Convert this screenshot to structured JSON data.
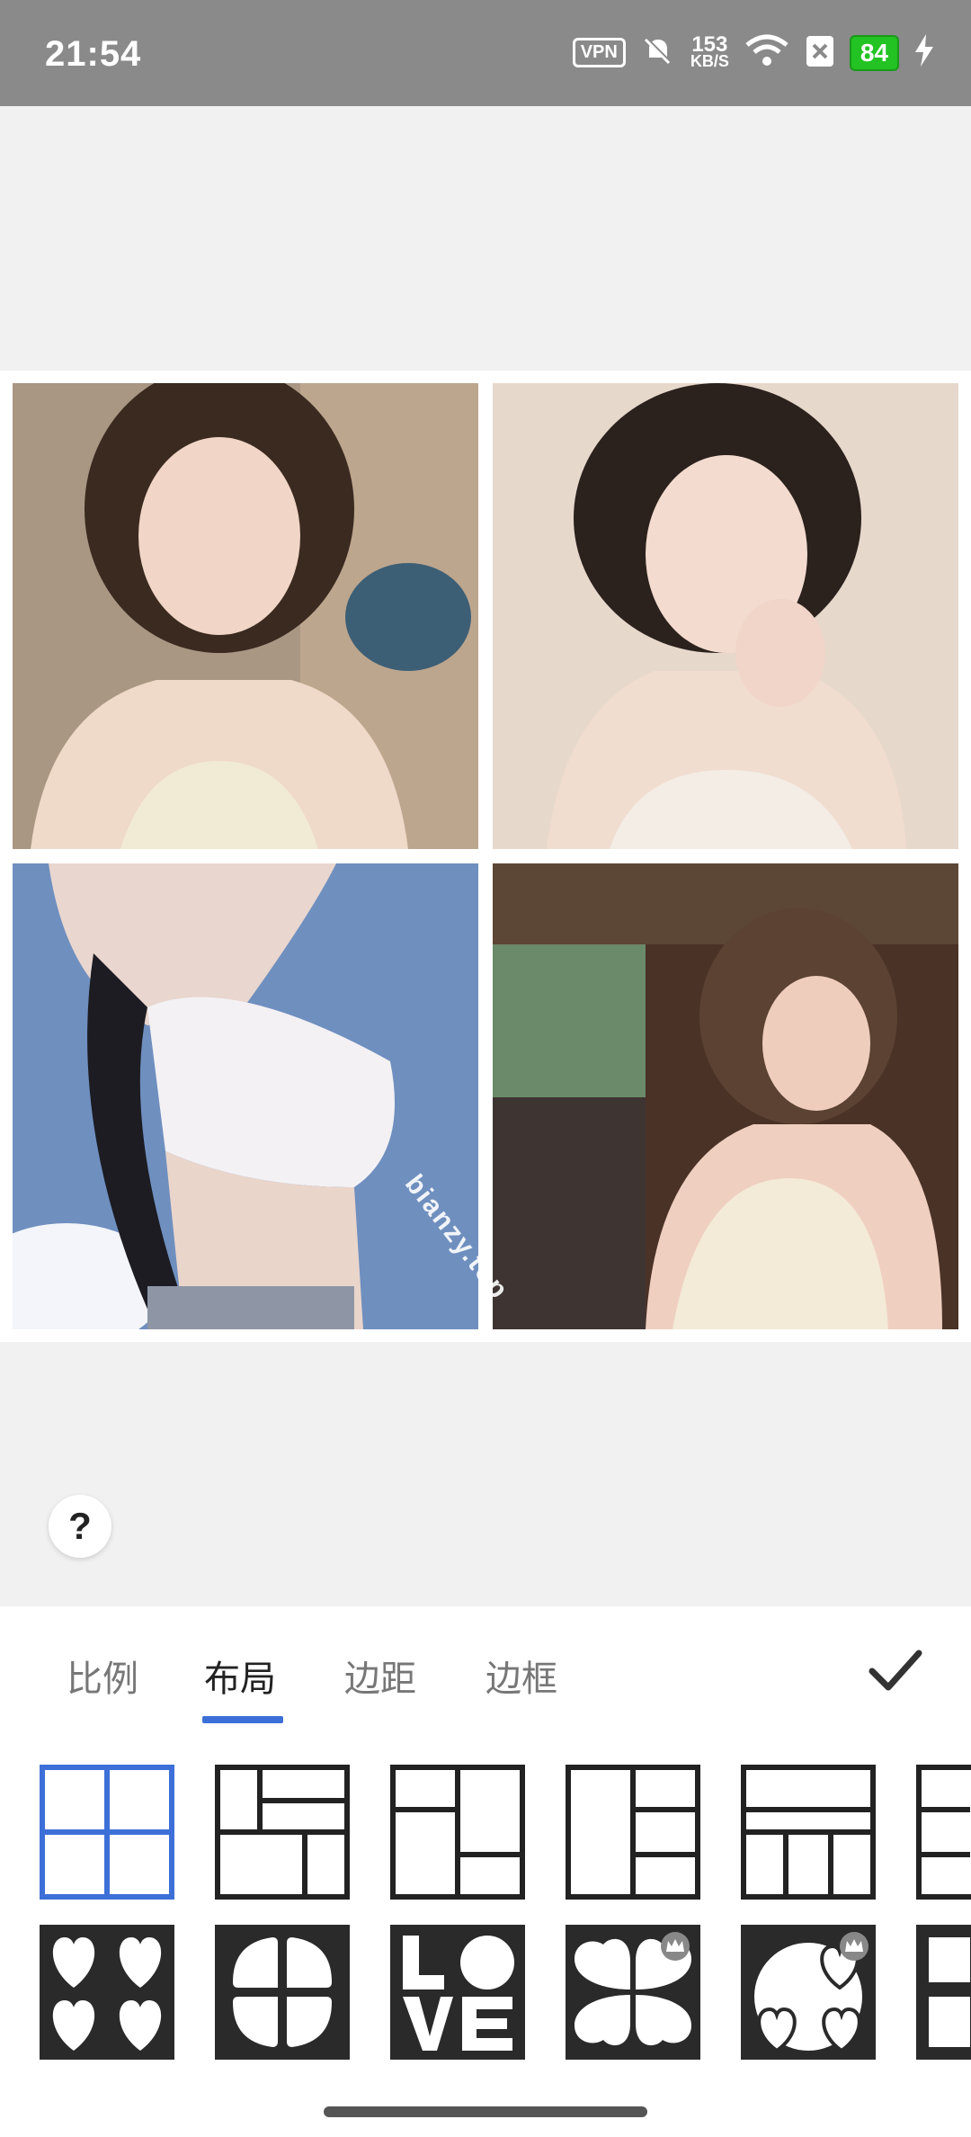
{
  "status": {
    "time": "21:54",
    "vpn": "VPN",
    "speed_value": "153",
    "speed_unit": "KB/S",
    "battery": "84"
  },
  "watermark": "bianzy.top",
  "tabs": [
    {
      "label": "比例",
      "active": false
    },
    {
      "label": "布局",
      "active": true
    },
    {
      "label": "边距",
      "active": false
    },
    {
      "label": "边框",
      "active": false
    }
  ],
  "colors": {
    "accent": "#3d6fd8",
    "status_bar": "#8a8a8a",
    "battery_green": "#22c322"
  },
  "layouts_row1": [
    "grid-2x2-icon",
    "layout-tall-left-icon",
    "layout-split-icon",
    "layout-columns-icon",
    "layout-bottom-three-icon"
  ],
  "layouts_row2": [
    "hearts-icon",
    "petals-icon",
    "love-letters-icon",
    "clover-icon",
    "heart-circle-icon"
  ]
}
